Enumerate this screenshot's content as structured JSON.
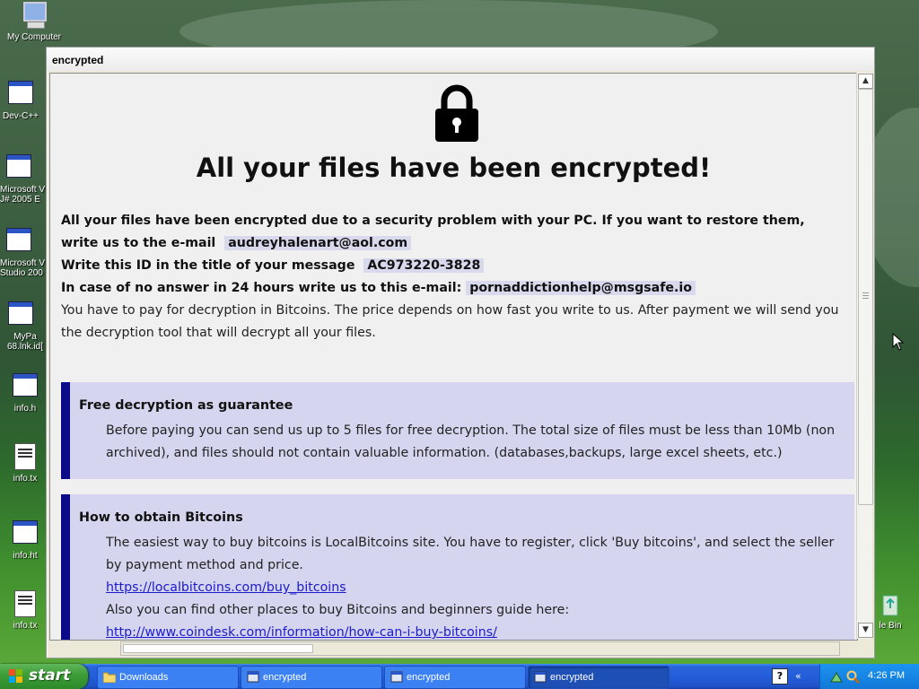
{
  "desktop": {
    "icons": [
      {
        "label": "My Computer",
        "icon": "computer-icon"
      },
      {
        "label": "Dev-C++",
        "icon": "program-icon"
      },
      {
        "label": "Microsoft V J# 2005 E",
        "icon": "program-icon"
      },
      {
        "label": "Microsoft V Studio 200",
        "icon": "program-icon"
      },
      {
        "label": "MyPa 68.lnk.id[",
        "icon": "program-icon"
      },
      {
        "label": "info.h",
        "icon": "html-file-icon"
      },
      {
        "label": "info.tx",
        "icon": "text-file-icon"
      },
      {
        "label": "info.ht",
        "icon": "html-file-icon"
      },
      {
        "label": "info.tx",
        "icon": "text-file-icon"
      },
      {
        "label": "le Bin",
        "icon": "recycle-bin-icon"
      }
    ]
  },
  "window": {
    "title": "encrypted"
  },
  "ransom": {
    "headline": "All your files have been encrypted!",
    "line1": "All your files have been encrypted due to a security problem with your PC. If you want to restore them, write us to the e-mail",
    "email1": "audreyhalenart@aol.com",
    "line2": "Write this ID in the title of your message",
    "id": "AC973220-3828",
    "line3": "In case of no answer in 24 hours write us to this e-mail:",
    "email2": "pornaddictionhelp@msgsafe.io",
    "line4": "You have to pay for decryption in Bitcoins. The price depends on how fast you write to us. After payment we will send you the decryption tool that will decrypt all your files.",
    "box1": {
      "title": "Free decryption as guarantee",
      "text": "Before paying you can send us up to 5 files for free decryption. The total size of files must be less than 10Mb (non archived), and files should not contain valuable information. (databases,backups, large excel sheets, etc.)"
    },
    "box2": {
      "title": "How to obtain Bitcoins",
      "text": "The easiest way to buy bitcoins is LocalBitcoins site. You have to register, click 'Buy bitcoins', and select the seller by payment method and price.",
      "link1": "https://localbitcoins.com/buy_bitcoins",
      "text2": "Also you can find other places to buy Bitcoins and beginners guide here:",
      "link2": "http://www.coindesk.com/information/how-can-i-buy-bitcoins/"
    }
  },
  "taskbar": {
    "start_label": "start",
    "tasks": [
      {
        "label": "Downloads",
        "icon": "folder-icon",
        "active": false
      },
      {
        "label": "encrypted",
        "icon": "app-icon",
        "active": false
      },
      {
        "label": "encrypted",
        "icon": "app-icon",
        "active": false
      },
      {
        "label": "encrypted",
        "icon": "app-icon",
        "active": true
      }
    ],
    "help_glyph": "?",
    "chevron": "«",
    "clock": "4:26 PM"
  },
  "colors": {
    "box_bg": "#d5d5ef",
    "box_border": "#0a0a8a",
    "highlight": "#d9d9ee",
    "link": "#1b1bcc"
  }
}
